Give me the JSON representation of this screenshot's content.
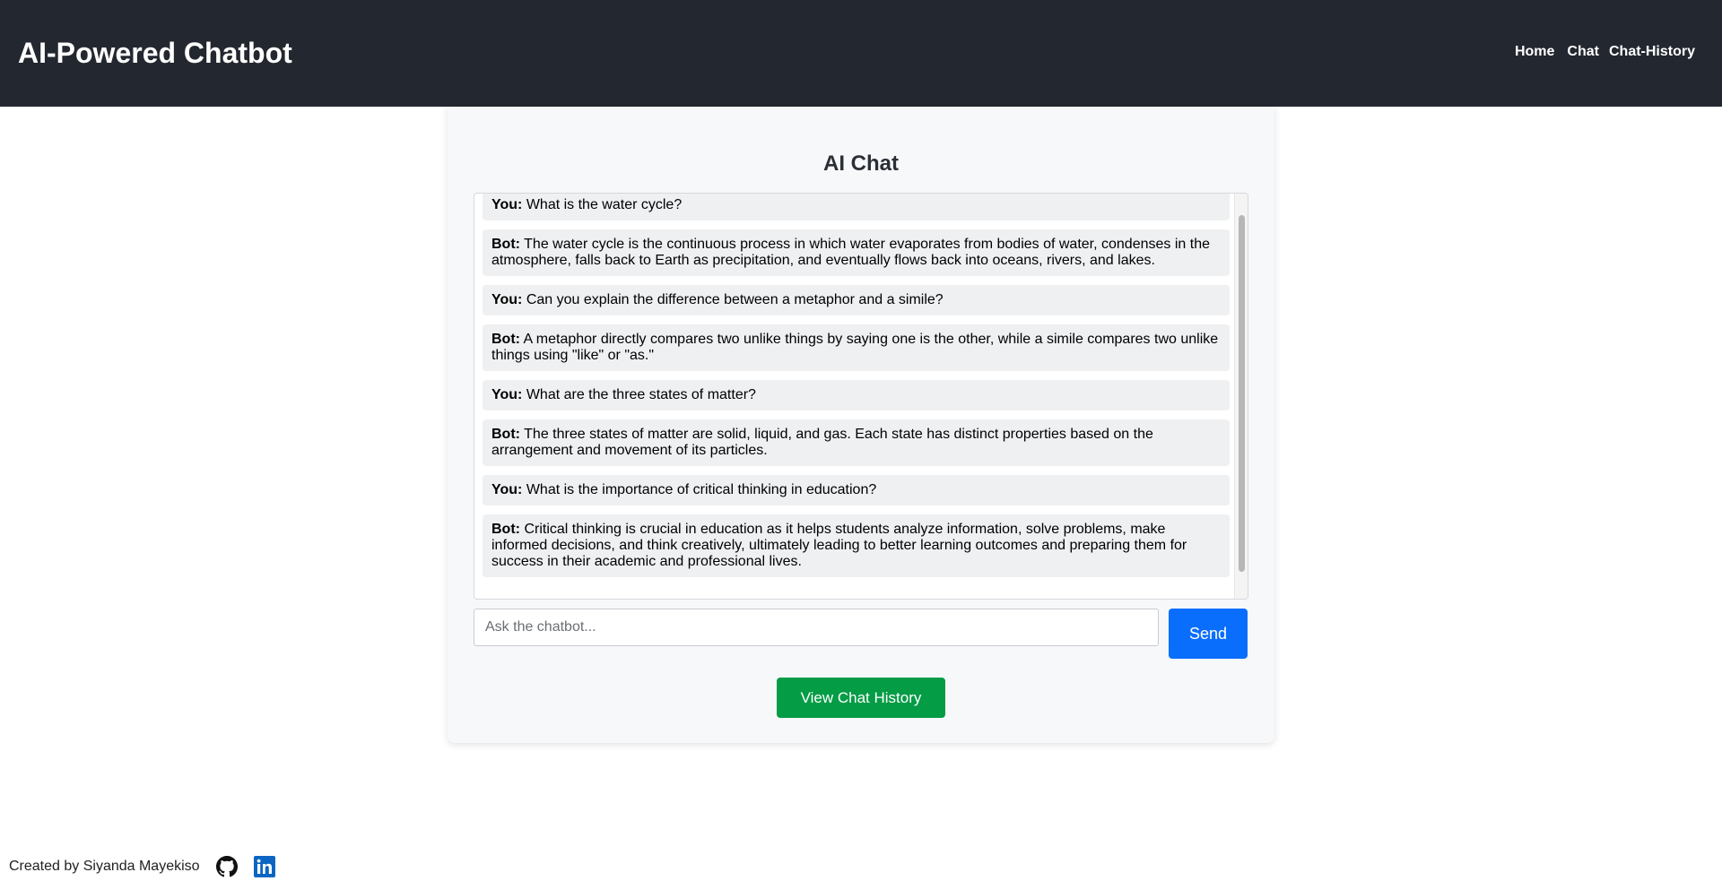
{
  "header": {
    "title": "AI-Powered Chatbot",
    "nav": [
      "Home",
      "Chat",
      "Chat-History"
    ]
  },
  "chat": {
    "title": "AI Chat",
    "messages": [
      {
        "sender": "You:",
        "text": "What is the water cycle?"
      },
      {
        "sender": "Bot:",
        "text": "The water cycle is the continuous process in which water evaporates from bodies of water, condenses in the atmosphere, falls back to Earth as precipitation, and eventually flows back into oceans, rivers, and lakes."
      },
      {
        "sender": "You:",
        "text": "Can you explain the difference between a metaphor and a simile?"
      },
      {
        "sender": "Bot:",
        "text": "A metaphor directly compares two unlike things by saying one is the other, while a simile compares two unlike things using \"like\" or \"as.\""
      },
      {
        "sender": "You:",
        "text": "What are the three states of matter?"
      },
      {
        "sender": "Bot:",
        "text": "The three states of matter are solid, liquid, and gas. Each state has distinct properties based on the arrangement and movement of its particles."
      },
      {
        "sender": "You:",
        "text": "What is the importance of critical thinking in education?"
      },
      {
        "sender": "Bot:",
        "text": "Critical thinking is crucial in education as it helps students analyze information, solve problems, make informed decisions, and think creatively, ultimately leading to better learning outcomes and preparing them for success in their academic and professional lives."
      }
    ],
    "input_placeholder": "Ask the chatbot...",
    "send_label": "Send",
    "history_label": "View Chat History"
  },
  "footer": {
    "credit": "Created by Siyanda Mayekiso",
    "icons": [
      "github-icon",
      "linkedin-icon"
    ]
  },
  "colors": {
    "header_bg": "#23272f",
    "send_button": "#0a6efd",
    "history_button": "#049c45",
    "linkedin": "#0a66c2"
  }
}
